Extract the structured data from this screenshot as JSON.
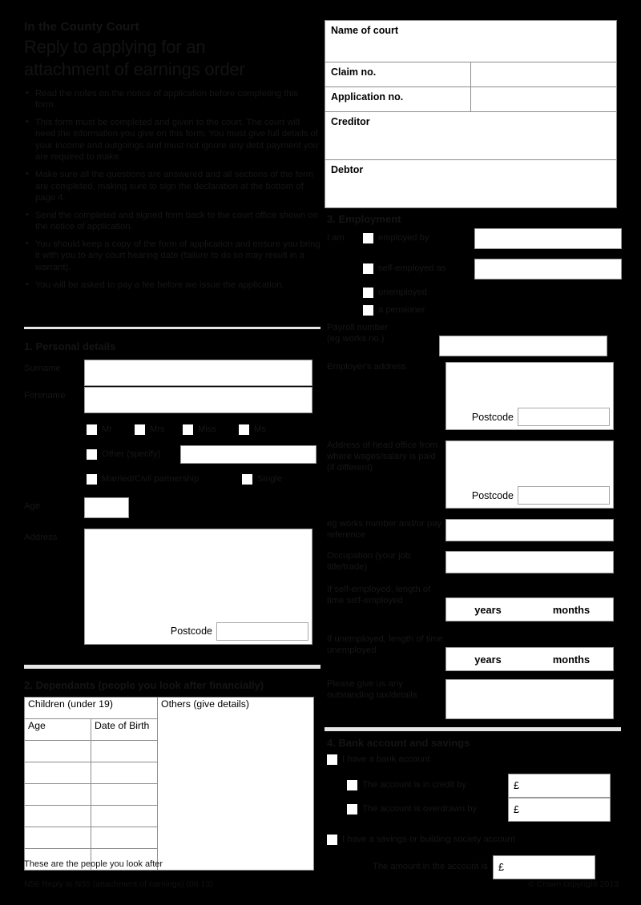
{
  "header": {
    "form_code": "In the County Court",
    "title_line1": "Reply to applying for an",
    "title_line2": "attachment of earnings order",
    "bullets": [
      "Read the notes on the notice of application before completing this form.",
      "This form must be completed and given to the court. The court will need the information you give on this form. You must give full details of your income and outgoings and must not ignore any debt payment you are required to make.",
      "Make sure all the questions are answered and all sections of the form are completed, making sure to sign the declaration at the bottom of page 4.",
      "Send the completed and signed form back to the court office shown on the notice of application.",
      "You should keep a copy of the form of application and ensure you bring it with you to any court hearing date (failure to do so may result in a warrant).",
      "You will be asked to pay a fee before we issue the application."
    ]
  },
  "court_details": {
    "name_of_court_label": "Name of court",
    "name_of_court_value": "",
    "claim_no_label": "Claim no.",
    "claim_no_value": "",
    "application_no_label": "Application no.",
    "application_no_value": "",
    "creditor_label": "Creditor",
    "creditor_value": "",
    "debtor_label": "Debtor",
    "debtor_value": ""
  },
  "personal_details": {
    "heading": "1. Personal details",
    "surname_label": "Surname",
    "surname_value": "",
    "forename_label": "Forename",
    "forename_value": "",
    "titles": [
      "Mr",
      "Mrs",
      "Miss",
      "Ms"
    ],
    "other_label": "Other (specify)",
    "other_value": "",
    "married_label": "Married/Civil partnership",
    "single_label": "Single",
    "age_label": "Age",
    "age_value": "",
    "address_label": "Address",
    "address_value": "",
    "postcode_label": "Postcode",
    "postcode_value": ""
  },
  "dependants": {
    "heading": "2. Dependants (people you look after financially)",
    "children_header": "Children (under 19)",
    "others_header": "Others (give details)",
    "age_header": "Age",
    "dob_header": "Date of Birth",
    "rows": [
      {
        "age": "",
        "dob": ""
      },
      {
        "age": "",
        "dob": ""
      },
      {
        "age": "",
        "dob": ""
      },
      {
        "age": "",
        "dob": ""
      },
      {
        "age": "",
        "dob": ""
      },
      {
        "age": "",
        "dob": ""
      }
    ],
    "others_value": "",
    "note": "These are the people you look after"
  },
  "employment": {
    "heading": "3. Employment",
    "i_am_label": "I am",
    "employed_by_label": "employed by",
    "employed_by_value": "",
    "self_employed_label": "self-employed as",
    "self_employed_value": "",
    "unemployed_label": "unemployed",
    "pensioner_label": "a pensioner",
    "payroll_label": "Payroll number\n(eg works no.)",
    "payroll_value": "",
    "employer_address_label": "Employer's address",
    "employer_address_value": "",
    "employer_postcode_label": "Postcode",
    "employer_postcode_value": "",
    "head_office_label": "Address of head office from where wages/salary is paid (if different)",
    "head_office_value": "",
    "head_office_postcode_label": "Postcode",
    "head_office_postcode_value": "",
    "pay_reference_label": "eg works number and/or pay reference",
    "pay_reference_value": "",
    "occupation_label": "Occupation (your job title/trade)",
    "occupation_value": "",
    "self_employed_length_label": "If self-employed, length of time self-employed",
    "self_employed_years_label": "years",
    "self_employed_months_label": "months",
    "unemployed_length_label": "If unemployed, length of time unemployed",
    "unemployed_years_label": "years",
    "unemployed_months_label": "months",
    "outstanding_label": "Please give us any outstanding tax/details",
    "outstanding_value": ""
  },
  "bank": {
    "heading": "4. Bank account and savings",
    "have_account_label": "I have a bank account",
    "credit_label": "The account is in credit by",
    "overdrawn_label": "The account is overdrawn by",
    "currency": "£",
    "credit_value": "",
    "overdrawn_value": "",
    "savings_label": "I have a savings or building society account",
    "savings_amount_label": "The amount in the account is",
    "savings_value": ""
  },
  "footer": {
    "left": "N56 Reply to N55 (attachment of earnings) (06.13)",
    "right": "© Crown copyright 2013"
  }
}
